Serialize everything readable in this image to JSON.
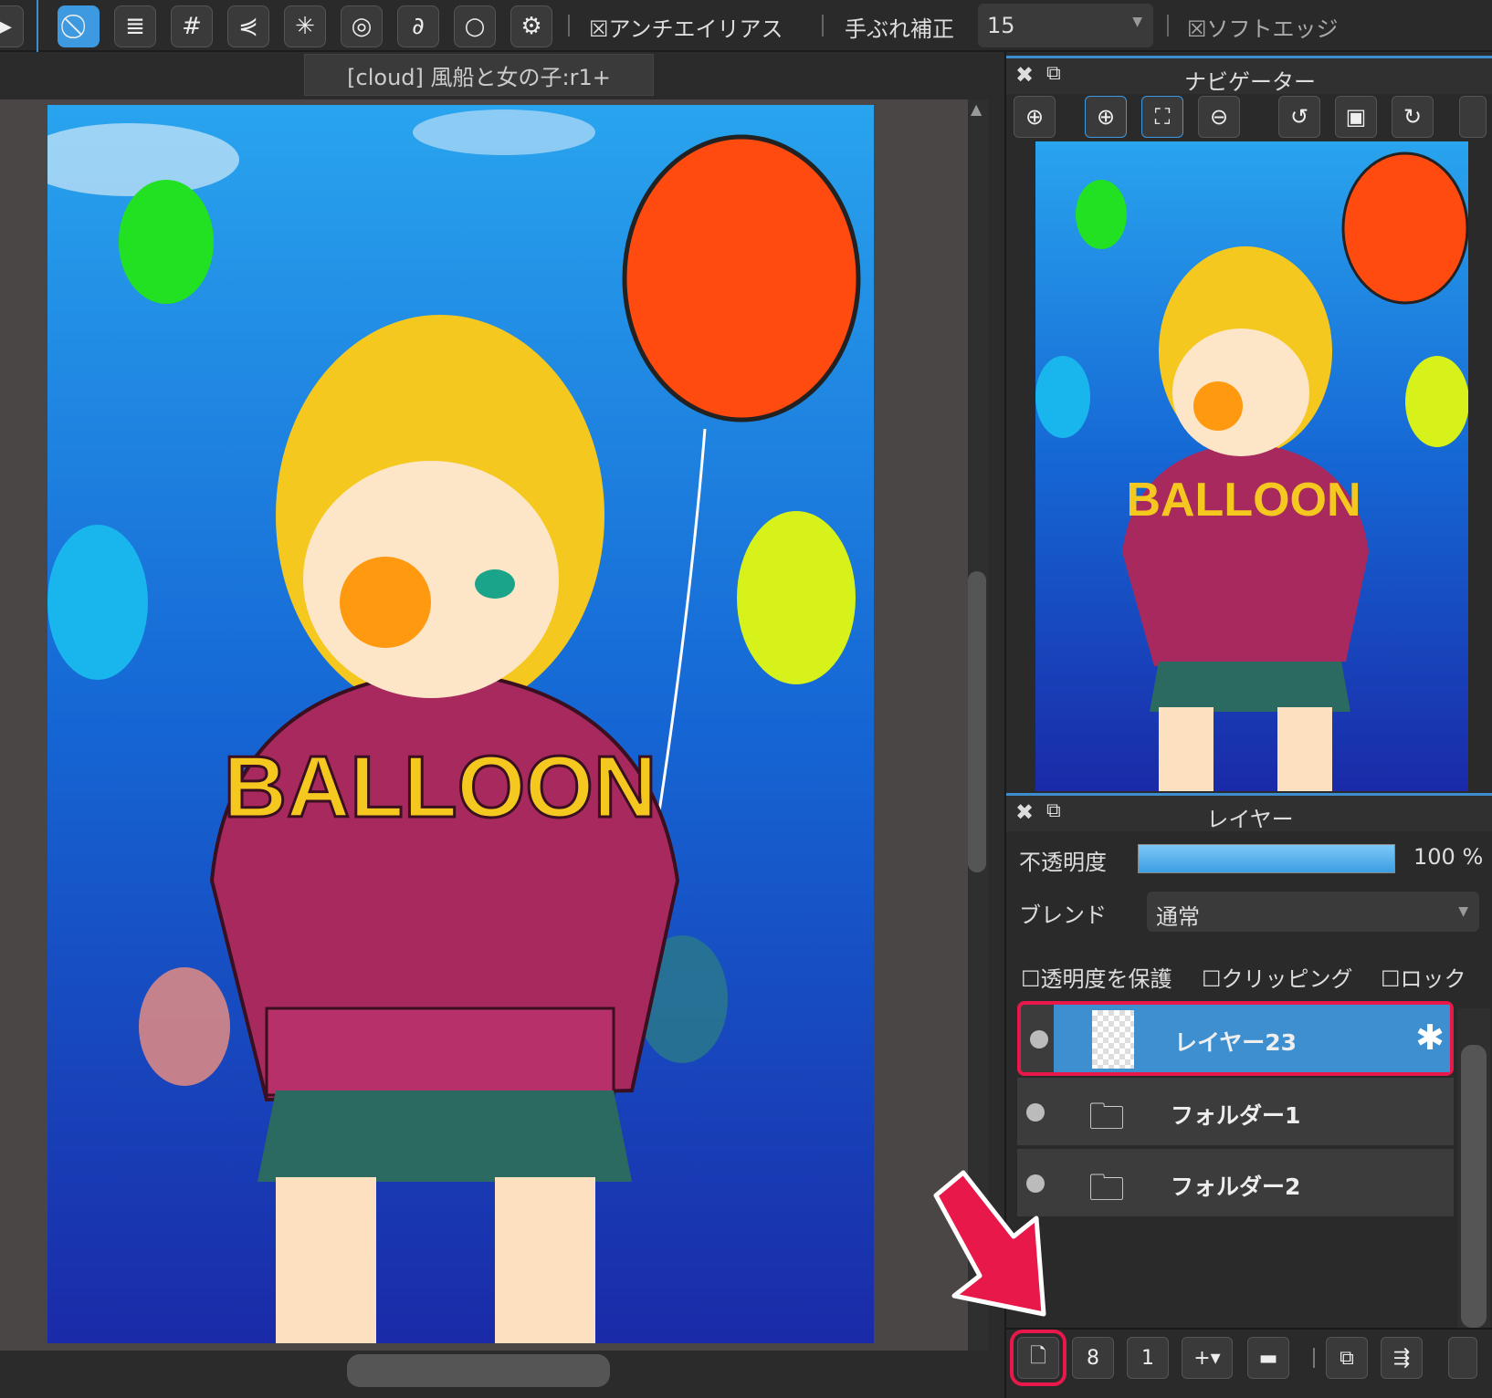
{
  "toolbar": {
    "tools": [
      "forbidden-icon",
      "parallel-lines-icon",
      "grid-icon",
      "perspective-icon",
      "radial-icon",
      "concentric-icon",
      "curve-icon",
      "circle-icon",
      "gear-icon"
    ],
    "antialias_label": "アンチエイリアス",
    "stabilizer_label": "手ぶれ補正",
    "stabilizer_value": "15",
    "soft_edge_label": "ソフトエッジ"
  },
  "document_tab": "[cloud] 風船と女の子:r1+",
  "artwork": {
    "shirt_text": "BALLOON"
  },
  "navigator": {
    "title": "ナビゲーター"
  },
  "layers_panel": {
    "title": "レイヤー",
    "opacity_label": "不透明度",
    "opacity_value": "100 %",
    "opacity_percent": 100,
    "blend_label": "ブレンド",
    "blend_value": "通常",
    "protect_alpha": "透明度を保護",
    "clipping": "クリッピング",
    "lock": "ロック",
    "layers": [
      {
        "name": "レイヤー23",
        "selected": true
      },
      {
        "name": "フォルダー1"
      },
      {
        "name": "フォルダー2"
      }
    ]
  },
  "colors": {
    "accent": "#3d9ae0",
    "highlight": "#e8194a"
  }
}
